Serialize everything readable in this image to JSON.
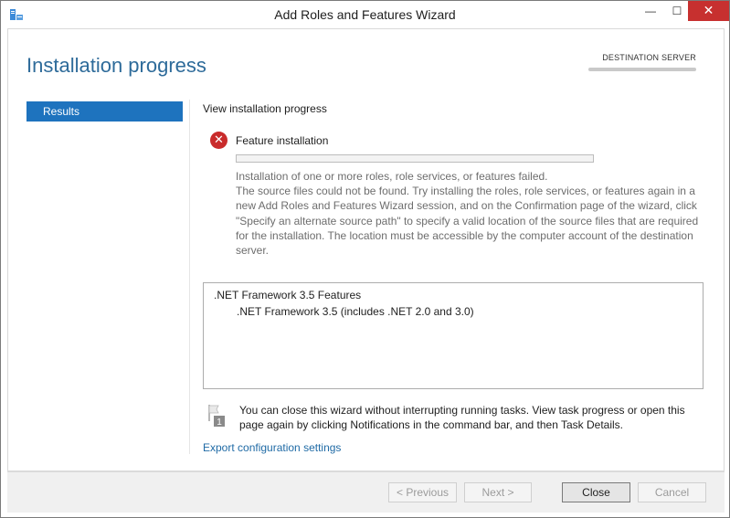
{
  "window": {
    "title": "Add Roles and Features Wizard",
    "minimize_glyph": "—",
    "maximize_glyph": "☐",
    "close_glyph": "✕"
  },
  "header": {
    "page_title": "Installation progress",
    "destination_label": "DESTINATION SERVER"
  },
  "sidebar": {
    "items": [
      {
        "label": "Results",
        "selected": true
      }
    ]
  },
  "main": {
    "heading": "View installation progress",
    "status": {
      "label": "Feature installation",
      "icon": "error-icon",
      "progress": 0.0
    },
    "message_lines": [
      "Installation of one or more roles, role services, or features failed.",
      "The source files could not be found. Try installing the roles, role services, or features again in a new Add Roles and Features Wizard session, and on the Confirmation page of the wizard, click \"Specify an alternate source path\" to specify a valid location of the source files that are required for the installation. The location must be accessible by the computer account of the destination server."
    ],
    "results": {
      "parent": ".NET Framework 3.5 Features",
      "child": ".NET Framework 3.5 (includes .NET 2.0 and 3.0)"
    },
    "notice": {
      "icon": "flag-icon",
      "badge": "1",
      "text": "You can close this wizard without interrupting running tasks. View task progress or open this page again by clicking Notifications in the command bar, and then Task Details."
    },
    "export_link": "Export configuration settings"
  },
  "footer": {
    "previous_label": "< Previous",
    "next_label": "Next >",
    "close_label": "Close",
    "cancel_label": "Cancel"
  },
  "colors": {
    "title_accent": "#2e6b9a",
    "selection": "#1e73be",
    "error": "#c92b2b",
    "link": "#1f6aa5",
    "close_button": "#c7302f"
  }
}
